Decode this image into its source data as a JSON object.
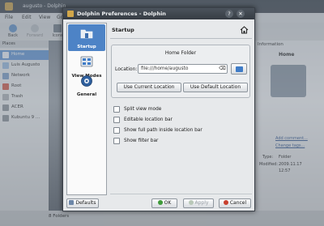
{
  "background": {
    "window_title": "augusto - Dolphin",
    "menu": [
      "File",
      "Edit",
      "View",
      "Go"
    ],
    "toolbar": [
      "Back",
      "Forward",
      "Icons"
    ],
    "places_title": "Places",
    "places": [
      "Home",
      "Luis Augusto",
      "Network",
      "Root",
      "Trash",
      "ACER",
      "Kubuntu 9 ..."
    ],
    "info_panel": {
      "header": "Information",
      "name": "Home",
      "add_comment": "Add comment...",
      "change_tags": "Change tags...",
      "type_label": "Type:",
      "type_value": "Folder",
      "modified_label": "Modified:",
      "modified_value": "2009.11.17",
      "modified_time": "12:57"
    },
    "status": "8 Folders"
  },
  "dialog": {
    "title": "Dolphin Preferences - Dolphin",
    "help": "?",
    "sidebar": [
      {
        "label": "Startup",
        "icon": "startup-icon",
        "selected": true
      },
      {
        "label": "View Modes",
        "icon": "view-modes-icon",
        "selected": false
      },
      {
        "label": "General",
        "icon": "general-icon",
        "selected": false
      }
    ],
    "page_title": "Startup",
    "home_folder": {
      "title": "Home Folder",
      "location_label": "Location:",
      "location_value": "file:///home/augusto",
      "use_current": "Use Current Location",
      "use_default": "Use Default Location"
    },
    "options": [
      "Split view mode",
      "Editable location bar",
      "Show full path inside location bar",
      "Show filter bar"
    ],
    "buttons": {
      "defaults": "Defaults",
      "ok": "OK",
      "apply": "Apply",
      "cancel": "Cancel"
    }
  },
  "colors": {
    "selection": "#4d83c6",
    "titlebar": "#3e454d"
  }
}
